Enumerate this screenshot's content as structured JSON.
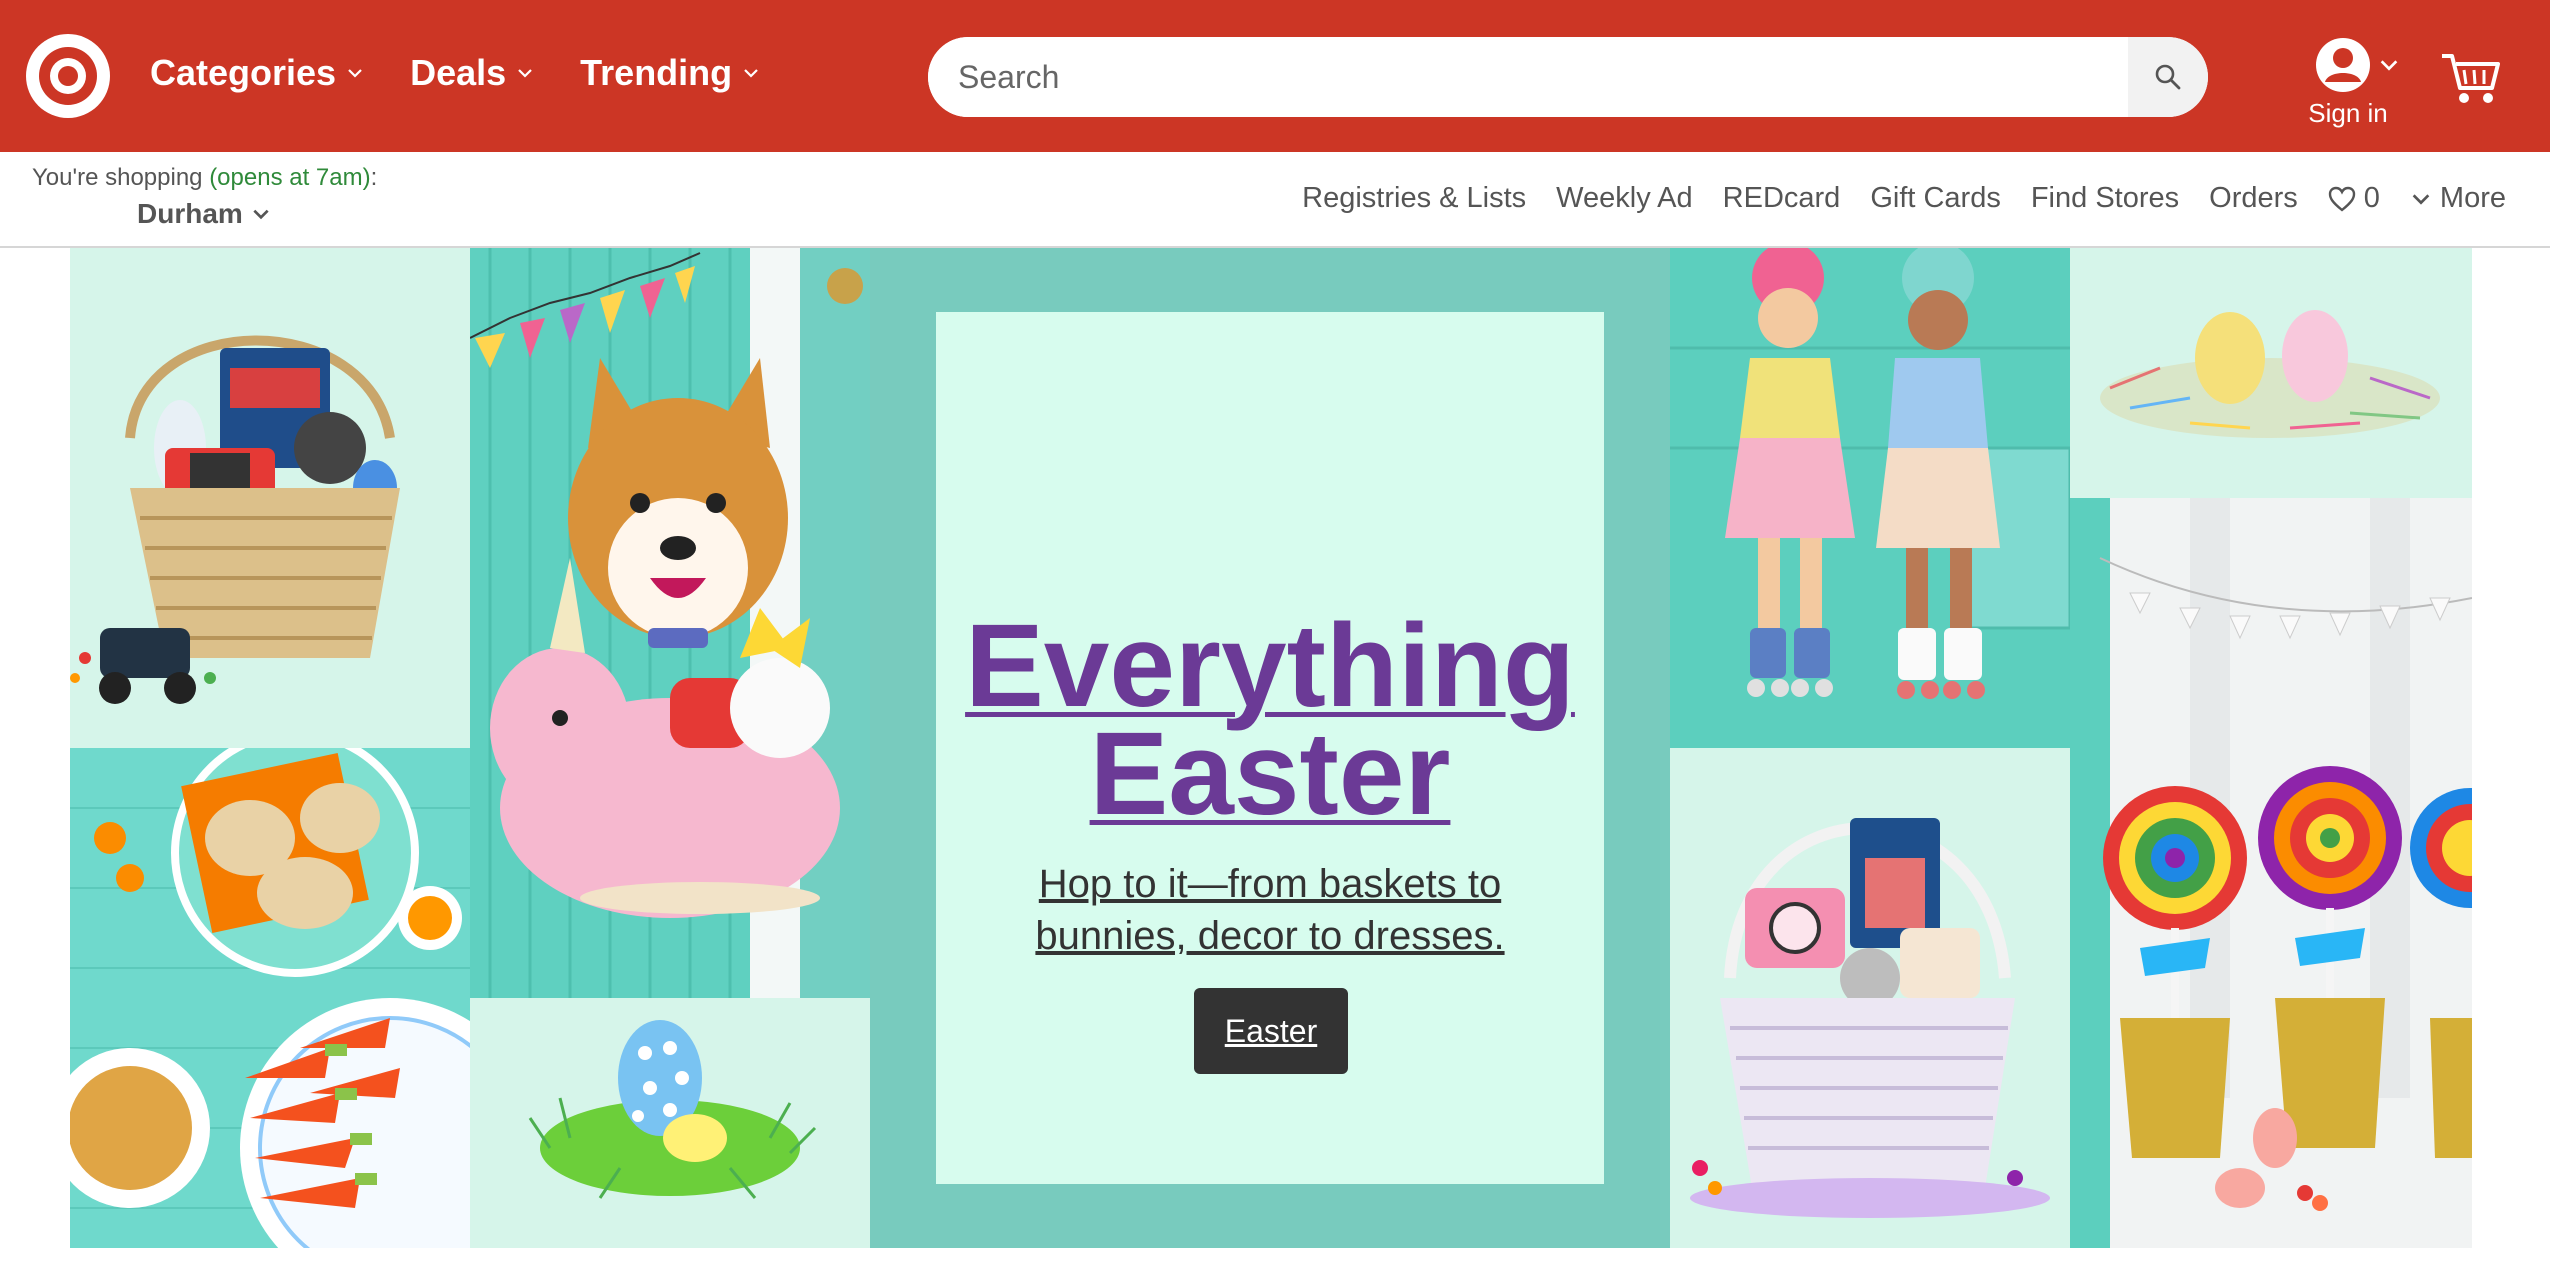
{
  "header": {
    "nav": [
      {
        "label": "Categories"
      },
      {
        "label": "Deals"
      },
      {
        "label": "Trending"
      }
    ],
    "search": {
      "placeholder": "Search"
    },
    "account": {
      "label": "Sign in"
    },
    "colors": {
      "brand": "#cc3625"
    }
  },
  "subheader": {
    "store_prefix": "You're shopping ",
    "store_hours": "(opens at 7am)",
    "store_suffix": ":",
    "store_name": "Durham",
    "links": [
      {
        "label": "Registries & Lists"
      },
      {
        "label": "Weekly Ad"
      },
      {
        "label": "REDcard"
      },
      {
        "label": "Gift Cards"
      },
      {
        "label": "Find Stores"
      },
      {
        "label": "Orders"
      }
    ],
    "favorites_count": "0",
    "more_label": "More"
  },
  "hero": {
    "headline": "Everything Easter",
    "subline": "Hop to it—from baskets to bunnies, decor to dresses.",
    "button_label": "Easter",
    "images": [
      {
        "name": "easter-basket-toys-image"
      },
      {
        "name": "corgi-unicorn-image"
      },
      {
        "name": "bunny-sandwich-plates-image"
      },
      {
        "name": "easter-egg-grass-image"
      },
      {
        "name": "girls-roller-skates-image"
      },
      {
        "name": "pink-basket-image"
      },
      {
        "name": "eggs-nest-image"
      },
      {
        "name": "lollipops-image"
      }
    ]
  }
}
